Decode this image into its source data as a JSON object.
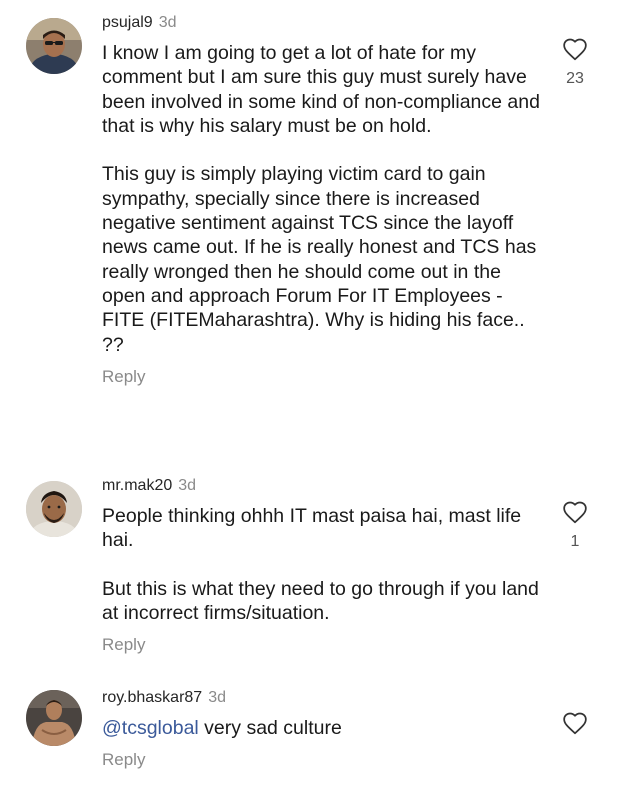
{
  "comments": [
    {
      "username": "psujal9",
      "time": "3d",
      "paragraphs": [
        "I know I am going to get a lot of hate for my comment but I am sure this guy must surely have been involved in some kind of non-compliance and that is why his salary must be on hold.",
        "This guy is simply playing victim card to gain sympathy, specially since there is increased negative sentiment against TCS since the layoff news came out. If he is really honest and TCS has really wronged then he should come out in the open and approach Forum For IT Employees - FITE (FITEMaharashtra). Why is hiding his face.. ??"
      ],
      "likes": "23",
      "reply_label": "Reply"
    },
    {
      "username": "mr.mak20",
      "time": "3d",
      "paragraphs": [
        "People thinking ohhh IT mast paisa hai, mast life hai.",
        "But this is what they need to go through if you land at incorrect firms/situation."
      ],
      "likes": "1",
      "reply_label": "Reply"
    },
    {
      "username": "roy.bhaskar87",
      "time": "3d",
      "mention": "@tcsglobal",
      "text": " very sad culture",
      "likes": "",
      "reply_label": "Reply"
    }
  ],
  "icons": {
    "like": "heart-outline-icon"
  },
  "colors": {
    "mention": "#3b5a9a",
    "secondary_text": "#8a8a8a"
  }
}
